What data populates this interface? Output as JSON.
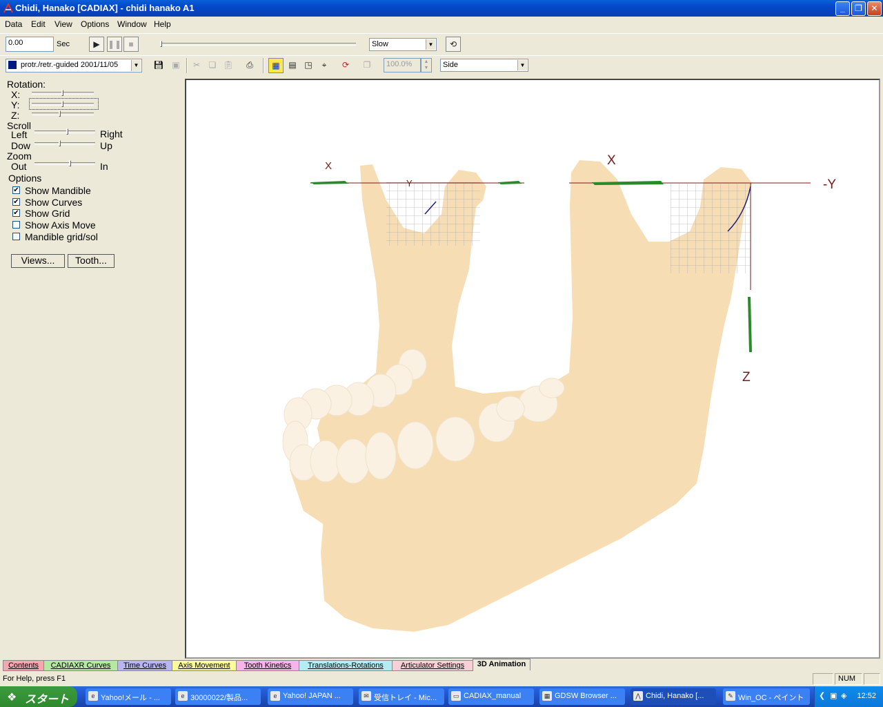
{
  "window": {
    "title": "Chidi, Hanako [CADIAX] - chidi hanako A1"
  },
  "menu": [
    "Data",
    "Edit",
    "View",
    "Options",
    "Window",
    "Help"
  ],
  "playback": {
    "time_value": "0.00",
    "time_unit": "Sec",
    "speed": "Slow"
  },
  "toolbar2": {
    "recording": "protr./retr.-guided 2001/11/05",
    "zoom": "100.0%",
    "view": "Side"
  },
  "left_panel": {
    "rotation_label": "Rotation:",
    "rot_x": "X:",
    "rot_y": "Y:",
    "rot_z": "Z:",
    "rot_x_pos": 0.5,
    "rot_y_pos": 0.5,
    "rot_z_pos": 0.45,
    "scroll_label": "Scroll",
    "left": "Left",
    "right": "Right",
    "down": "Dow",
    "up": "Up",
    "scroll_h_pos": 0.55,
    "scroll_v_pos": 0.42,
    "zoom_label": "Zoom",
    "out": "Out",
    "in": "In",
    "zoom_pos": 0.6,
    "options_label": "Options",
    "options": [
      {
        "label": "Show Mandible",
        "checked": true
      },
      {
        "label": "Show Curves",
        "checked": true
      },
      {
        "label": "Show Grid",
        "checked": true
      },
      {
        "label": "Show Axis Move",
        "checked": false
      },
      {
        "label": "Mandible grid/sol",
        "checked": false
      }
    ],
    "views_button": "Views...",
    "tooth_button": "Tooth..."
  },
  "scene": {
    "axis_x_left": "X",
    "axis_y_left": "Y",
    "axis_x_right": "X",
    "axis_neg_y": "-Y",
    "axis_z": "Z",
    "bone_color": "#f7ddb4",
    "teeth_color": "#fbf1e2"
  },
  "tabs": [
    {
      "label": "Contents",
      "color": "#f6a6b0"
    },
    {
      "label": "CADIAXR Curves",
      "color": "#b5e8a2"
    },
    {
      "label": "Time Curves",
      "color": "#b7b6f2"
    },
    {
      "label": "Axis Movement",
      "color": "#fbfb9c"
    },
    {
      "label": "Tooth Kinetics",
      "color": "#f6b4ea"
    },
    {
      "label": "Translations-Rotations",
      "color": "#b4ecf4"
    },
    {
      "label": "Articulator Settings",
      "color": "#f8cfd6"
    },
    {
      "label": "3D Animation",
      "color": "#ece9d8"
    }
  ],
  "status": {
    "help": "For Help, press F1",
    "num": "NUM"
  },
  "taskbar": {
    "start": "スタート",
    "tasks": [
      "Yahoo!メール - ...",
      "30000022/製品...",
      "Yahoo! JAPAN ...",
      "受信トレイ - Mic...",
      "CADIAX_manual",
      "GDSW Browser ...",
      "Chidi, Hanako [...",
      "Win_OC - ペイント"
    ],
    "clock": "12:52"
  }
}
